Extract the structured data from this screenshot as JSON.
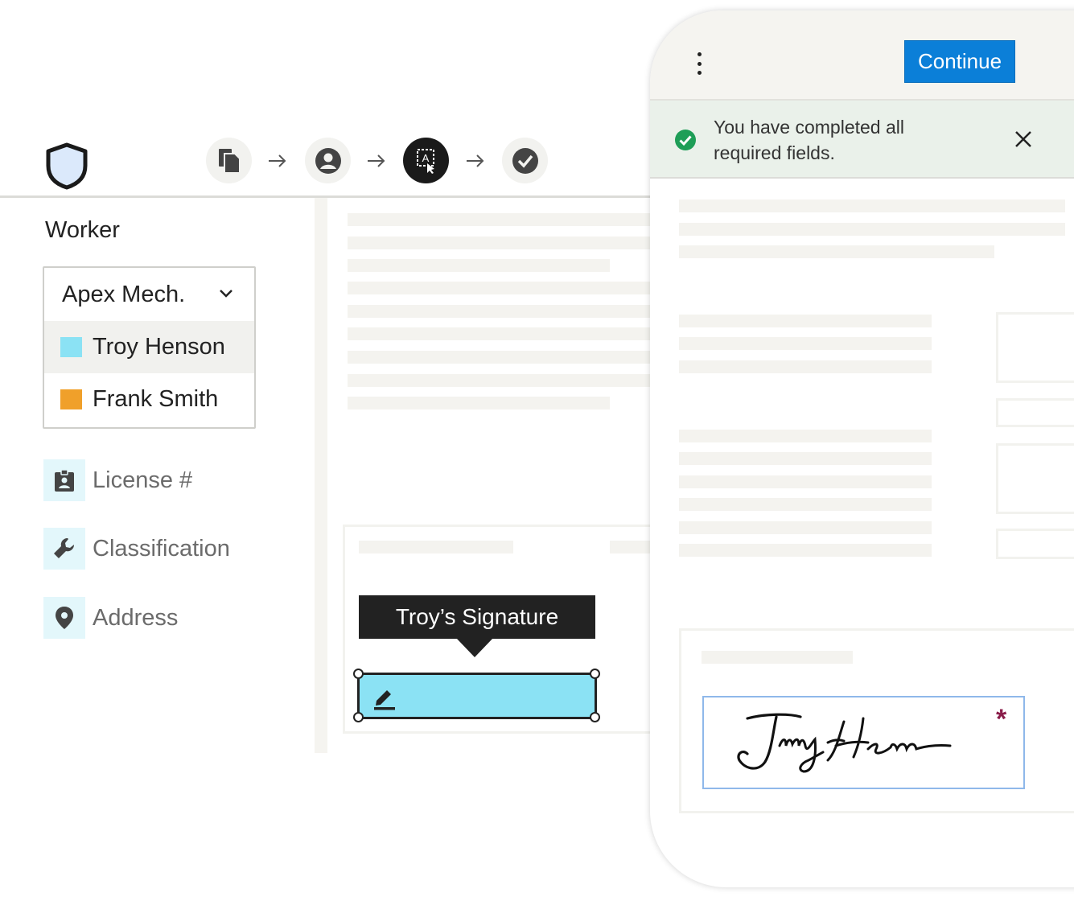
{
  "stepper": {
    "steps": [
      {
        "icon": "documents-icon",
        "state": "done"
      },
      {
        "icon": "person-icon",
        "state": "done"
      },
      {
        "icon": "field-placement-icon",
        "state": "active"
      },
      {
        "icon": "checkmark-icon",
        "state": "pending"
      }
    ]
  },
  "sidebar": {
    "worker_label": "Worker",
    "dropdown": {
      "selected": "Apex Mech.",
      "options": [
        {
          "label": "Troy Henson",
          "color": "#8be2f4",
          "highlighted": true
        },
        {
          "label": "Frank Smith",
          "color": "#f0a02a",
          "highlighted": false
        }
      ]
    },
    "fields": [
      {
        "label": "License #",
        "icon": "id-badge-icon"
      },
      {
        "label": "Classification",
        "icon": "wrench-icon"
      },
      {
        "label": "Address",
        "icon": "location-pin-icon"
      }
    ]
  },
  "document": {
    "tooltip": "Troy’s Signature",
    "signature_field_color": "#8be2f4"
  },
  "phone": {
    "continue_label": "Continue",
    "banner_message": "You have completed all required fields.",
    "required_marker": "*"
  },
  "colors": {
    "accent": "#0b7fd8",
    "success": "#1e9e57",
    "required": "#8a1d4a"
  }
}
